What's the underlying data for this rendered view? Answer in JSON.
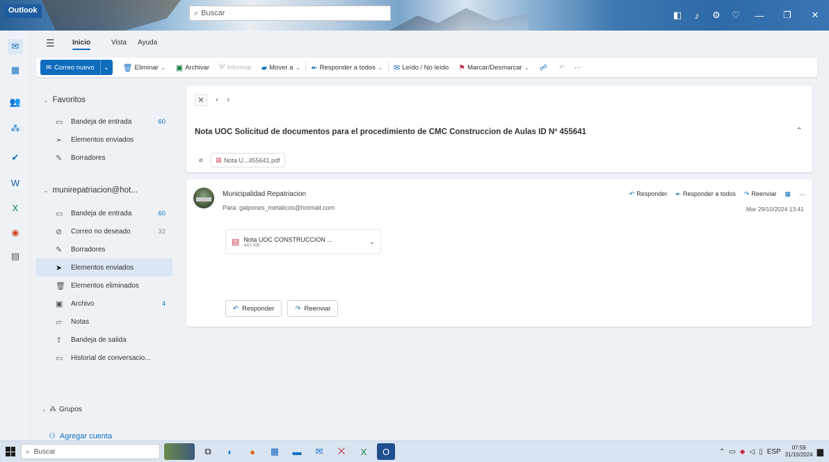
{
  "app": {
    "name": "Outlook"
  },
  "search": {
    "placeholder": "Buscar"
  },
  "ribbon_tabs": [
    "Inicio",
    "Vista",
    "Ayuda"
  ],
  "toolbar": {
    "new_mail": "Correo nuevo",
    "delete": "Eliminar",
    "archive": "Archivar",
    "report": "Informar",
    "move_to": "Mover a",
    "reply_all": "Responder a todos",
    "read_unread": "Leído / No leído",
    "flag": "Marcar/Desmarcar",
    "more": "···"
  },
  "folders": {
    "favorites_label": "Favoritos",
    "favorites": [
      {
        "label": "Bandeja de entrada",
        "count": "60",
        "icon": "inbox-icon"
      },
      {
        "label": "Elementos enviados",
        "count": "",
        "icon": "send-icon"
      },
      {
        "label": "Borradores",
        "count": "",
        "icon": "draft-icon"
      }
    ],
    "account_label": "munirepatriacion@hot...",
    "account_folders": [
      {
        "label": "Bandeja de entrada",
        "count": "60",
        "icon": "inbox-icon"
      },
      {
        "label": "Correo no deseado",
        "count": "32",
        "icon": "junk-icon"
      },
      {
        "label": "Borradores",
        "count": "",
        "icon": "draft-icon"
      },
      {
        "label": "Elementos enviados",
        "count": "",
        "icon": "send-icon",
        "selected": true
      },
      {
        "label": "Elementos eliminados",
        "count": "",
        "icon": "trash-icon"
      },
      {
        "label": "Archivo",
        "count": "4",
        "icon": "archive-icon"
      },
      {
        "label": "Notas",
        "count": "",
        "icon": "notes-icon"
      },
      {
        "label": "Bandeja de salida",
        "count": "",
        "icon": "outbox-icon"
      },
      {
        "label": "Historial de conversacio...",
        "count": "",
        "icon": "history-icon"
      }
    ],
    "groups_label": "Grupos",
    "add_account": "Agregar cuenta"
  },
  "thread": {
    "subject": "Nota  UOC Solicitud de documentos para el procedimiento de CMC Construccion de Aulas ID Nº 455641",
    "attachment_chip": "Nota U...455641.pdf"
  },
  "message": {
    "sender": "Municipalidad Repatriacion",
    "recipient": "Para:  galpones_metalicos@hotmail.com",
    "date": "Mar 29/10/2024 13:41",
    "reply": "Responder",
    "reply_all": "Responder a todos",
    "forward": "Reenviar",
    "attachment_name": "Nota UOC CONSTRUCCION ...",
    "attachment_size": "441 KB"
  },
  "taskbar": {
    "search": "Buscar",
    "lang": "ESP",
    "time": "07:59",
    "date": "31/10/2024"
  },
  "colors": {
    "accent": "#0f6cbd",
    "pdf": "#c4314b"
  }
}
